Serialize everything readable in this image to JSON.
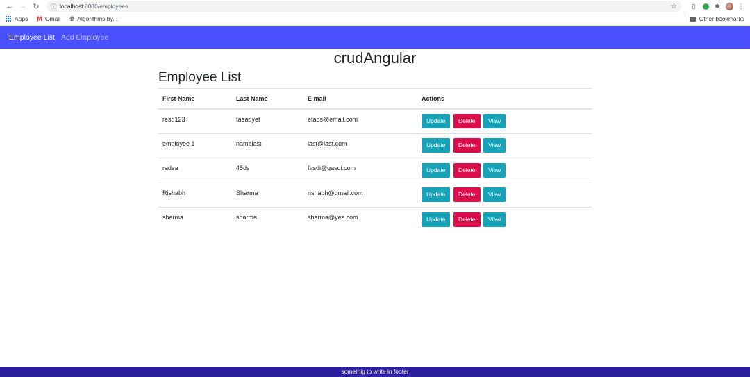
{
  "browser": {
    "url_host": "localhost",
    "url_rest": ":8080/employees",
    "bookmarks": [
      {
        "label": "Apps",
        "icon": "apps-grid-icon"
      },
      {
        "label": "Gmail",
        "icon": "gmail-icon"
      },
      {
        "label": "Algorithms by...",
        "icon": "globe-icon"
      }
    ],
    "other_bookmarks": "Other bookmarks"
  },
  "navbar": {
    "link_list": "Employee List",
    "link_add": "Add Employee",
    "color": "#4b50ff"
  },
  "app_title": "crudAngular",
  "page_heading": "Employee List",
  "table": {
    "headers": [
      "First Name",
      "Last Name",
      "E mail",
      "Actions"
    ],
    "rows": [
      {
        "first": "resd123",
        "last": "taeadyet",
        "email": "etads@email.com"
      },
      {
        "first": "employee 1",
        "last": "namelast",
        "email": "last@last.com"
      },
      {
        "first": "radsa",
        "last": "45ds",
        "email": "fasdi@gasdi.com"
      },
      {
        "first": "Rishabh",
        "last": "Sharma",
        "email": "rishabh@gmail.com"
      },
      {
        "first": "sharma",
        "last": "sharma",
        "email": "sharma@yes.com"
      }
    ],
    "actions": {
      "update": "Update",
      "delete": "Delete",
      "view": "View"
    }
  },
  "colors": {
    "info": "#17a2b8",
    "danger": "#dc0d4b",
    "footer": "#2c1f9e"
  },
  "footer_text": "somethig to write in footer"
}
